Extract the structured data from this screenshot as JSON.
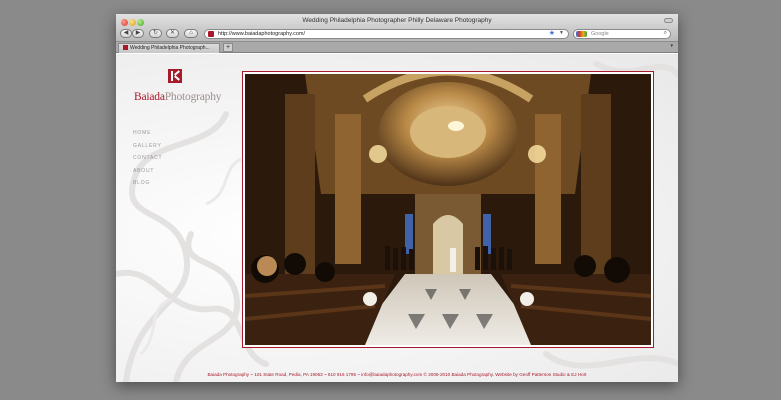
{
  "browser": {
    "window_title": "Wedding Philadelphia Photographer Philly Delaware Photography",
    "url": "http://www.baiadaphotography.com/",
    "search_placeholder": "Google",
    "tab_label": "Wedding Philadelphia Photograph...",
    "new_tab_symbol": "+"
  },
  "site": {
    "logo_primary": "Baiada",
    "logo_secondary": "Photography",
    "nav": [
      "HOME",
      "GALLERY",
      "CONTACT",
      "ABOUT",
      "BLOG"
    ],
    "footer": "Baiada Photography ~ 101 State Road, Pedia, PA 19063 ~ 610 916 1795 ~ info@baiadaphotography.com © 2008-2010 Baiada Photography. Website by Geoff Patterson Studio & EJ Hort"
  },
  "colors": {
    "brand": "#a8192b",
    "chrome": "#c9c9c9"
  }
}
